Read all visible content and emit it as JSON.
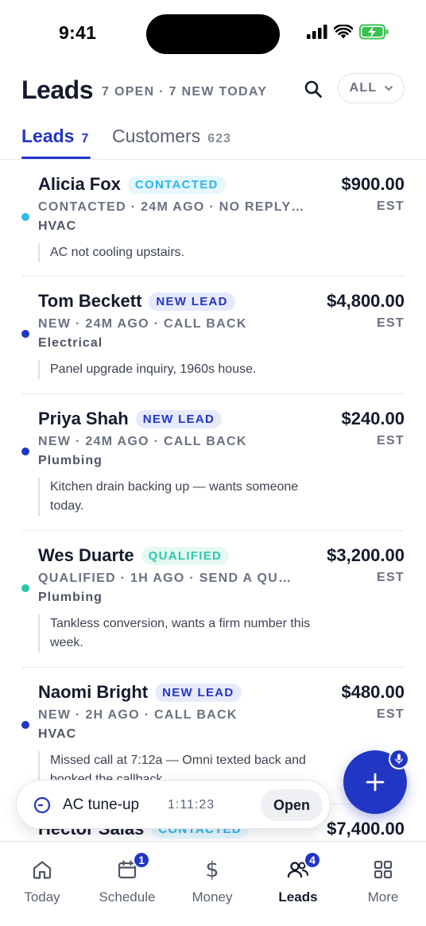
{
  "status_bar": {
    "time": "9:41"
  },
  "header": {
    "title": "Leads",
    "subtitle": "7 OPEN · 7 NEW TODAY",
    "filter_label": "ALL"
  },
  "tabs": [
    {
      "label": "Leads",
      "count": "7",
      "active": true
    },
    {
      "label": "Customers",
      "count": "623",
      "active": false
    }
  ],
  "leads": [
    {
      "name": "Alicia Fox",
      "status": "CONTACTED",
      "meta": "CONTACTED · 24M AGO · NO REPLY…",
      "trade": "HVAC",
      "note": "AC not cooling upstairs.",
      "amount": "$900.00",
      "amount_label": "EST",
      "dot_color": "#33b8ec"
    },
    {
      "name": "Tom Beckett",
      "status": "NEW LEAD",
      "meta": "NEW · 24M AGO · CALL BACK",
      "trade": "Electrical",
      "note": "Panel upgrade inquiry, 1960s house.",
      "amount": "$4,800.00",
      "amount_label": "EST",
      "dot_color": "#2236c4"
    },
    {
      "name": "Priya Shah",
      "status": "NEW LEAD",
      "meta": "NEW · 24M AGO · CALL BACK",
      "trade": "Plumbing",
      "note": "Kitchen drain backing up — wants someone today.",
      "amount": "$240.00",
      "amount_label": "EST",
      "dot_color": "#2236c4"
    },
    {
      "name": "Wes Duarte",
      "status": "QUALIFIED",
      "meta": "QUALIFIED · 1H AGO · SEND A QU…",
      "trade": "Plumbing",
      "note": "Tankless conversion, wants a firm number this week.",
      "amount": "$3,200.00",
      "amount_label": "EST",
      "dot_color": "#2cc9ab"
    },
    {
      "name": "Naomi Bright",
      "status": "NEW LEAD",
      "meta": "NEW · 2H AGO · CALL BACK",
      "trade": "HVAC",
      "note": "Missed call at 7:12a — Omni texted back and booked the callback.",
      "amount": "$480.00",
      "amount_label": "EST",
      "dot_color": "#2236c4"
    },
    {
      "name": "Hector Salas",
      "status": "CONTACTED",
      "meta": "",
      "trade": "",
      "note": "",
      "amount": "$7,400.00",
      "amount_label": "",
      "dot_color": "#33b8ec"
    }
  ],
  "timer": {
    "title": "AC tune-up",
    "elapsed": "1:11:23",
    "open_label": "Open"
  },
  "nav": [
    {
      "label": "Today",
      "icon": "home-icon",
      "badge": ""
    },
    {
      "label": "Schedule",
      "icon": "calendar-icon",
      "badge": "1"
    },
    {
      "label": "Money",
      "icon": "dollar-icon",
      "badge": ""
    },
    {
      "label": "Leads",
      "icon": "users-icon",
      "badge": "4",
      "active": true
    },
    {
      "label": "More",
      "icon": "grid-icon",
      "badge": ""
    }
  ],
  "colors": {
    "primary": "#2236c4",
    "contacted": "#33b8ec",
    "qualified": "#2cc9ab",
    "text": "#141b2d",
    "muted": "#6a7282"
  }
}
